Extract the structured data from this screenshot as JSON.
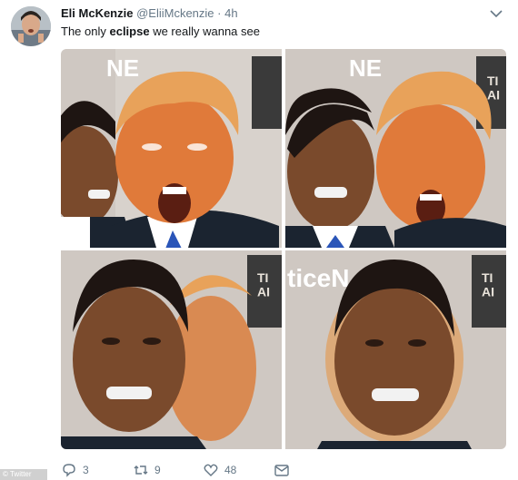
{
  "tweet": {
    "author_name": "Eli McKenzie",
    "handle": "@EliiMckenzie",
    "separator": "·",
    "time": "4h",
    "text_before": "The only ",
    "text_bold": "eclipse",
    "text_after": " we really wanna see"
  },
  "actions": {
    "reply_count": "3",
    "retweet_count": "9",
    "like_count": "48"
  },
  "watermark": "© Twitter",
  "images": {
    "backdrop_text_top": "NE",
    "backdrop_text_bottom": "ticeN",
    "banner_letters": "TI\nAI"
  },
  "colors": {
    "text": "#14171a",
    "muted": "#657786",
    "trump_skin": "#e07a3a",
    "trump_hair": "#e8a25a",
    "obama_skin": "#7a4a2c",
    "suit": "#1b2430",
    "tie": "#2a55b8"
  },
  "icons": {
    "caret": "chevron-down-icon",
    "reply": "reply-icon",
    "retweet": "retweet-icon",
    "like": "heart-icon",
    "dm": "direct-message-icon"
  }
}
